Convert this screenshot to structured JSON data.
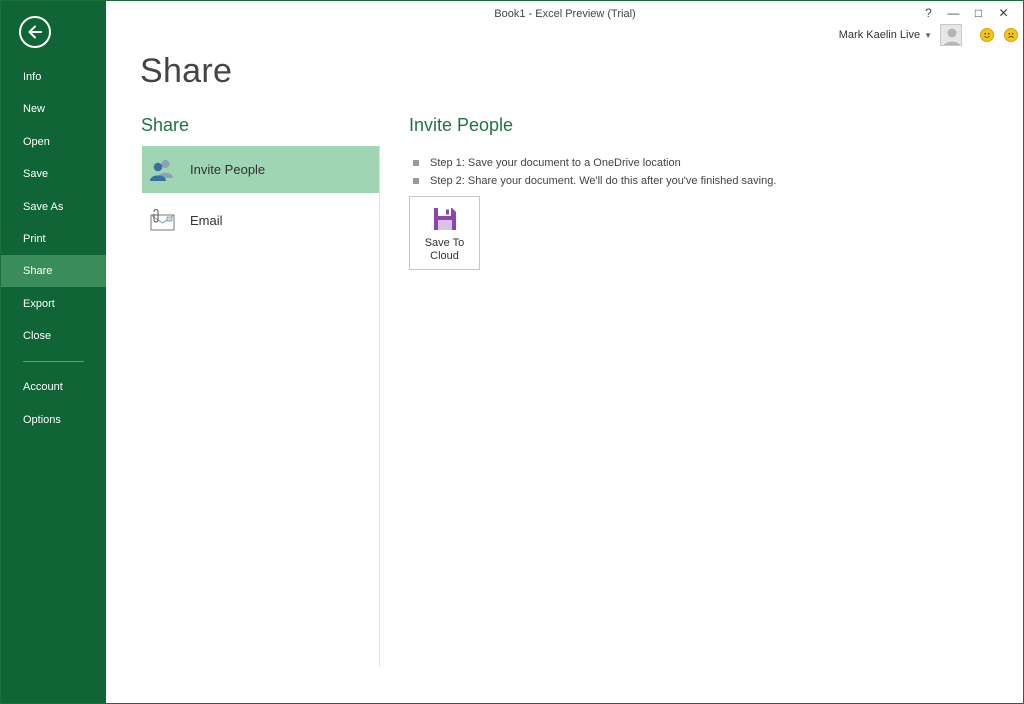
{
  "window": {
    "title": "Book1 - Excel Preview (Trial)",
    "controls": [
      "?",
      "—",
      "□",
      "✕"
    ]
  },
  "account": {
    "user_name": "Mark Kaelin Live",
    "feedback_icons": [
      "smile-icon",
      "frown-icon"
    ]
  },
  "sidebar": {
    "back_icon": "back-arrow-icon",
    "items": [
      {
        "label": "Info"
      },
      {
        "label": "New"
      },
      {
        "label": "Open"
      },
      {
        "label": "Save"
      },
      {
        "label": "Save As"
      },
      {
        "label": "Print"
      },
      {
        "label": "Share",
        "active": true
      },
      {
        "label": "Export"
      },
      {
        "label": "Close"
      },
      {
        "label": "Account"
      },
      {
        "label": "Options"
      }
    ]
  },
  "main": {
    "page_title": "Share",
    "share_section_title": "Share",
    "share_options": [
      {
        "label": "Invite People",
        "icon": "people-icon",
        "selected": true
      },
      {
        "label": "Email",
        "icon": "email-icon",
        "selected": false
      }
    ],
    "detail_title": "Invite People",
    "steps": [
      "Step 1: Save your document to a OneDrive location",
      "Step 2: Share your document. We'll do this after you've finished saving."
    ],
    "save_to_cloud": {
      "line1": "Save To",
      "line2": "Cloud",
      "icon": "floppy-disk-icon"
    }
  },
  "colors": {
    "sidebar_bg": "#0f6535",
    "sidebar_active": "#3a8c59",
    "accent_green": "#217346",
    "selected_option": "#9fd5b2",
    "floppy_purple": "#8e44ad"
  }
}
